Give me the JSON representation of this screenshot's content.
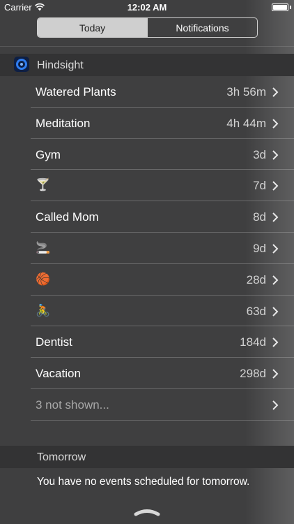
{
  "status_bar": {
    "carrier": "Carrier",
    "time": "12:02 AM",
    "battery_level": 1.0
  },
  "segmented": {
    "today_label": "Today",
    "notifications_label": "Notifications",
    "selected": "Today"
  },
  "widget": {
    "title": "Hindsight",
    "icon": "hindsight-app-icon",
    "items": [
      {
        "label": "Watered Plants",
        "value": "3h 56m"
      },
      {
        "label": "Meditation",
        "value": "4h 44m"
      },
      {
        "label": "Gym",
        "value": "3d"
      },
      {
        "label": "🍸",
        "value": "7d"
      },
      {
        "label": "Called Mom",
        "value": "8d"
      },
      {
        "label": "🚬",
        "value": "9d"
      },
      {
        "label": "🏀",
        "value": "28d"
      },
      {
        "label": "🚴",
        "value": "63d"
      },
      {
        "label": "Dentist",
        "value": "184d"
      },
      {
        "label": "Vacation",
        "value": "298d"
      },
      {
        "label": "3 not shown...",
        "value": ""
      }
    ]
  },
  "tomorrow": {
    "title": "Tomorrow",
    "message": "You have no events scheduled for tomorrow."
  },
  "colors": {
    "background": "#3f3f40",
    "header_background": "#333334",
    "accent_blue": "#2f7df0"
  }
}
